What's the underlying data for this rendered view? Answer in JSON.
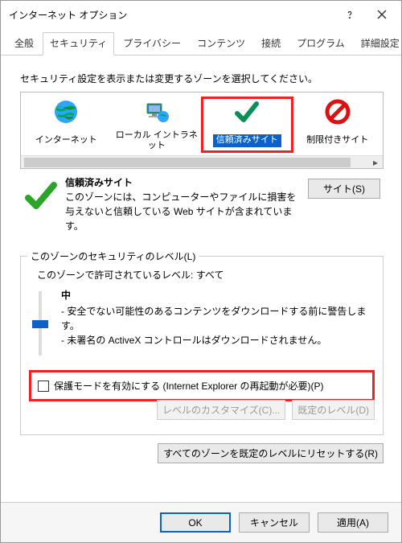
{
  "window": {
    "title": "インターネット オプション"
  },
  "tabs": {
    "general": "全般",
    "security": "セキュリティ",
    "privacy": "プライバシー",
    "content": "コンテンツ",
    "connections": "接続",
    "programs": "プログラム",
    "advanced": "詳細設定"
  },
  "instruction": "セキュリティ設定を表示または変更するゾーンを選択してください。",
  "zones": {
    "internet": "インターネット",
    "intranet": "ローカル イントラネット",
    "trusted": "信頼済みサイト",
    "restricted": "制限付きサイト"
  },
  "zoneDesc": {
    "name": "信頼済みサイト",
    "text": "このゾーンには、コンピューターやファイルに損害を与えないと信頼している Web サイトが含まれています。",
    "sitesBtn": "サイト(S)"
  },
  "group": {
    "label": "このゾーンのセキュリティのレベル(L)",
    "allowed": "このゾーンで許可されているレベル: すべて",
    "levelName": "中",
    "bullet1": "- 安全でない可能性のあるコンテンツをダウンロードする前に警告します。",
    "bullet2": "- 未署名の ActiveX コントロールはダウンロードされません。",
    "protectedMode": "保護モードを有効にする (Internet Explorer の再起動が必要)(P)",
    "customBtn": "レベルのカスタマイズ(C)...",
    "defaultBtn": "既定のレベル(D)"
  },
  "resetBtn": "すべてのゾーンを既定のレベルにリセットする(R)",
  "footer": {
    "ok": "OK",
    "cancel": "キャンセル",
    "apply": "適用(A)"
  }
}
